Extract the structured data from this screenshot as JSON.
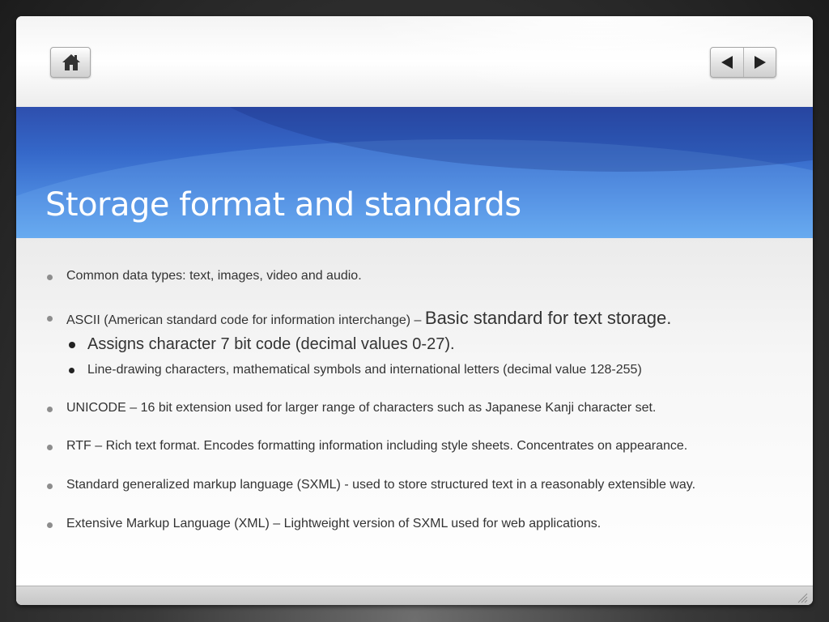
{
  "slide": {
    "title": "Storage format and standards"
  },
  "nav": {
    "home_icon": "home-icon",
    "prev_icon": "triangle-left-icon",
    "next_icon": "triangle-right-icon"
  },
  "bullets": {
    "b1": "Common data types: text, images, video and audio.",
    "b2_prefix": "ASCII (American standard code for information interchange) – ",
    "b2_emphasis": "Basic standard for text storage.",
    "b2_sub1": "Assigns character 7 bit code (decimal values 0-27).",
    "b2_sub2": "Line-drawing characters, mathematical symbols and international letters (decimal value 128-255)",
    "b3": "UNICODE – 16 bit extension used for larger range of characters such as Japanese Kanji character set.",
    "b4": "RTF – Rich text format. Encodes formatting information including style sheets.   Concentrates on appearance.",
    "b5": "Standard generalized markup language (SXML) -  used to store structured text in a reasonably extensible way.",
    "b6": "Extensive Markup Language (XML) – Lightweight version of SXML used for web applications."
  },
  "colors": {
    "title_band_top": "#2e4fae",
    "title_band_bottom": "#63a8ef",
    "title_text": "#ffffff",
    "body_text": "#333333"
  }
}
